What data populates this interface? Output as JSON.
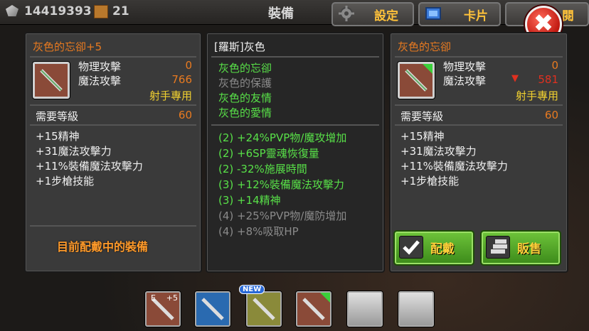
{
  "topbar": {
    "coins": "14419393",
    "boxes": "21",
    "title": "裝備",
    "settings_label": "設定",
    "cards_label": "卡片",
    "tab3_label": "閱"
  },
  "left_panel": {
    "item_name": "灰色的忘卻+5",
    "phys_label": "物理攻擊",
    "phys_value": "0",
    "magic_label": "魔法攻擊",
    "magic_value": "766",
    "class_restriction": "射手專用",
    "level_label": "需要等級",
    "level_value": "60",
    "stats": [
      "+15精神",
      "+31魔法攻擊力",
      "+11%裝備魔法攻擊力",
      "+1步槍技能"
    ],
    "equipped_banner": "目前配戴中的裝備"
  },
  "mid_panel": {
    "set_name": "[羅斯]灰色",
    "set_items": [
      {
        "name": "灰色的忘卻",
        "active": true
      },
      {
        "name": "灰色的保護",
        "active": false
      },
      {
        "name": "灰色的友情",
        "active": true
      },
      {
        "name": "灰色的愛情",
        "active": true
      }
    ],
    "bonuses": [
      {
        "text": "(2) +24%PVP物/魔攻增加",
        "active": true
      },
      {
        "text": "(2) +6SP靈魂恢復量",
        "active": true
      },
      {
        "text": "(2) -32%施展時間",
        "active": true
      },
      {
        "text": "(3) +12%裝備魔法攻擊力",
        "active": true
      },
      {
        "text": "(3) +14精神",
        "active": true
      },
      {
        "text": "(4) +25%PVP物/魔防增加",
        "active": false
      },
      {
        "text": "(4) +8%吸取HP",
        "active": false
      }
    ]
  },
  "right_panel": {
    "item_name": "灰色的忘卻",
    "phys_label": "物理攻擊",
    "phys_value": "0",
    "magic_label": "魔法攻擊",
    "magic_value": "581",
    "class_restriction": "射手專用",
    "level_label": "需要等級",
    "level_value": "60",
    "stats": [
      "+15精神",
      "+31魔法攻擊力",
      "+11%裝備魔法攻擊力",
      "+1步槍技能"
    ],
    "equip_button": "配戴",
    "sell_button": "販售"
  },
  "inventory": {
    "slot1_badge": "+5",
    "new_badge": "NEW"
  },
  "colors": {
    "accent_orange": "#e87a20",
    "set_green": "#58e048",
    "inactive_grey": "#8a8a8a",
    "button_green": "#5aa82a"
  }
}
